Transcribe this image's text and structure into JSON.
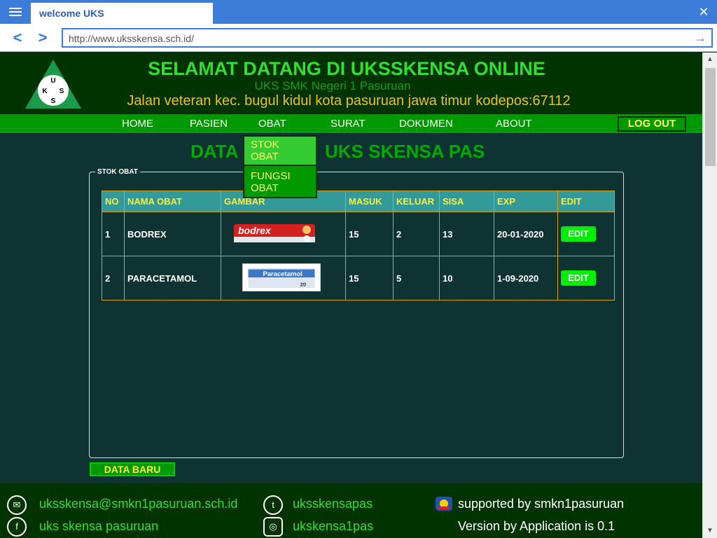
{
  "browser": {
    "tab_title": "welcome UKS",
    "url": "http://www.uksskensa.sch.id/"
  },
  "header": {
    "title": "SELAMAT DATANG DI UKSSKENSA ONLINE",
    "subtitle": "UKS SMK Negeri 1 Pasuruan",
    "address": "Jalan veteran kec. bugul kidul kota pasuruan jawa timur kodepos:67112",
    "logo_letters": [
      "U",
      "K",
      "S",
      "S"
    ]
  },
  "menu": {
    "home": "HOME",
    "pasien": "PASIEN",
    "obat": "OBAT",
    "surat": "SURAT",
    "dokumen": "DOKUMEN",
    "about": "ABOUT",
    "logout": "LOG OUT"
  },
  "dropdown": {
    "stok_obat": "STOK OBAT",
    "fungsi_obat": "FUNGSI OBAT"
  },
  "page": {
    "heading_left": "DATA",
    "heading_right": "UKS SKENSA PAS"
  },
  "fieldset": {
    "legend": "STOK OBAT"
  },
  "table": {
    "columns": [
      "NO",
      "NAMA OBAT",
      "GAMBAR",
      "MASUK",
      "KELUAR",
      "SISA",
      "EXP",
      "EDIT"
    ],
    "rows": [
      {
        "no": "1",
        "nama": "BODREX",
        "image": "bodrex-image",
        "masuk": "15",
        "keluar": "2",
        "sisa": "13",
        "exp": "20-01-2020",
        "edit": "EDIT"
      },
      {
        "no": "2",
        "nama": "PARACETAMOL",
        "image": "paracetamol-image",
        "masuk": "15",
        "keluar": "5",
        "sisa": "10",
        "exp": "1-09-2020",
        "edit": "EDIT"
      }
    ],
    "image_text": {
      "bodrex": "bodrex",
      "paracetamol": "Paracetamol",
      "paracetamol_count": "20"
    }
  },
  "actions": {
    "data_baru": "DATA BARU"
  },
  "footer": {
    "email": "uksskensa@smkn1pasuruan.sch.id",
    "facebook": "uks skensa pasuruan",
    "twitter": "uksskensapas",
    "instagram": "ukskensa1pas",
    "supported": "supported by smkn1pasuruan",
    "version": "Version by Application is 0.1"
  },
  "colors": {
    "accent_green": "#009900",
    "title_green": "#33dd33",
    "highlight_yellow": "#ffee33",
    "browser_blue": "#3b7dd8"
  }
}
